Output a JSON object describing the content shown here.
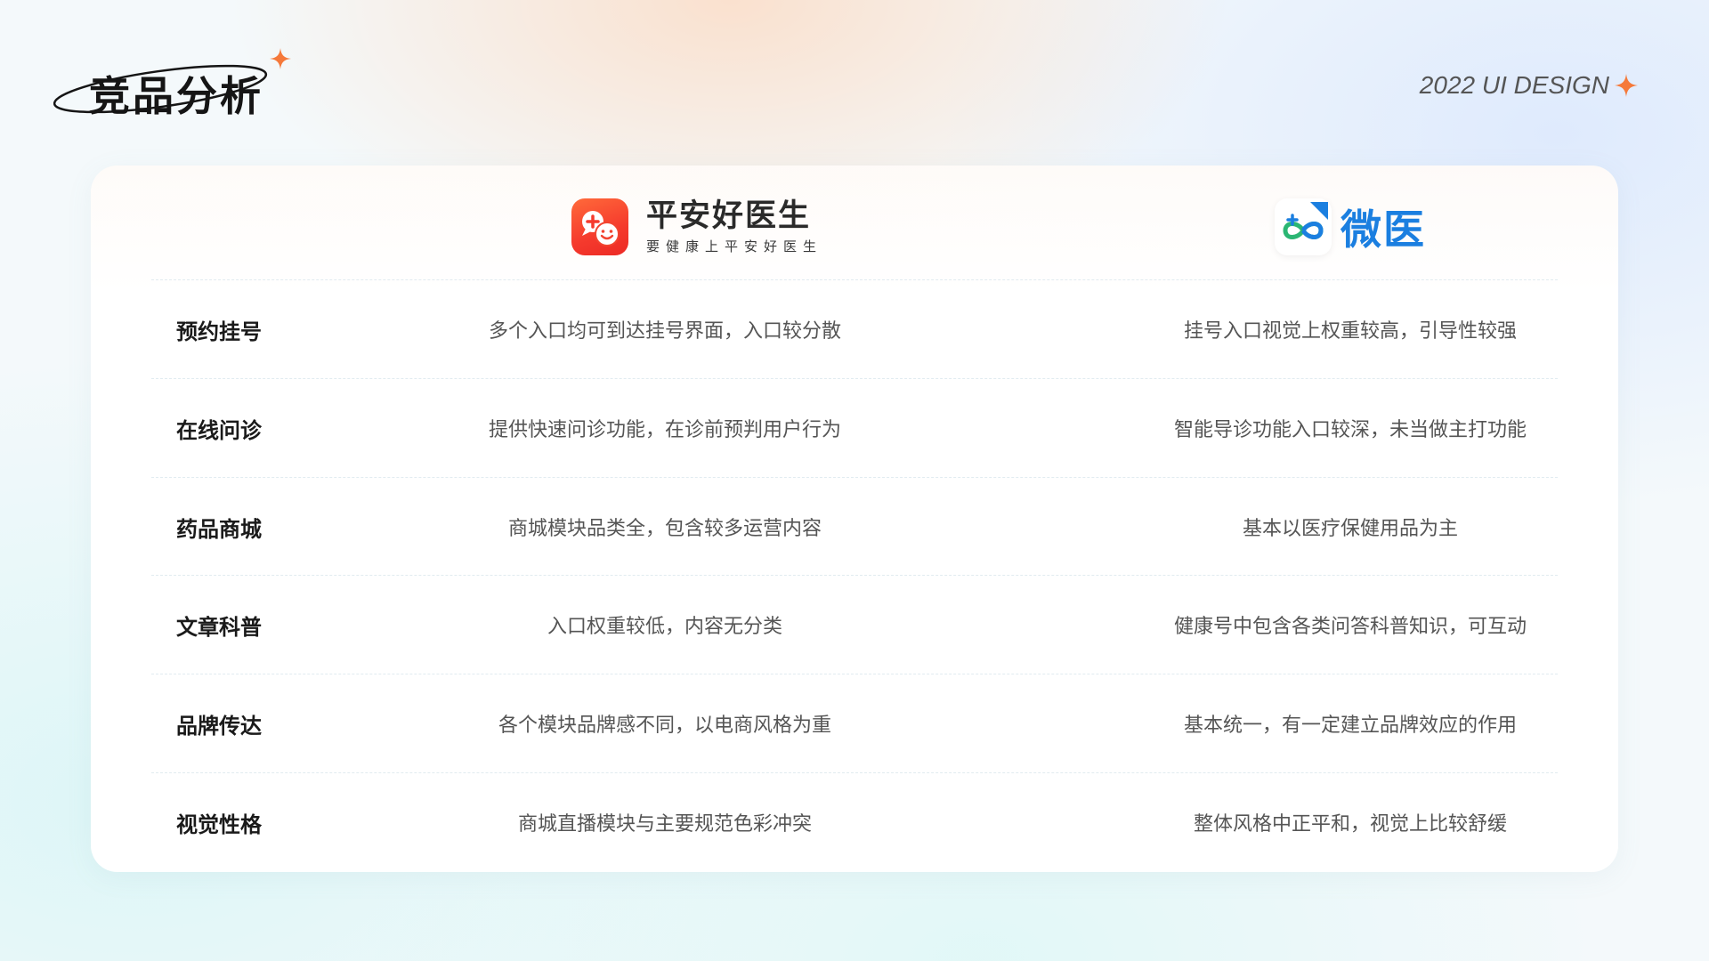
{
  "header": {
    "title": "竞品分析",
    "tag": "2022 UI DESIGN"
  },
  "colors": {
    "accent_orange": "#f5793a",
    "pingan_red": "#f53a2d",
    "weiyi_blue": "#1b7fe0",
    "weiyi_green": "#2bb673"
  },
  "products": {
    "pingan": {
      "name": "平安好医生",
      "slogan": "要健康上平安好医生",
      "icon": "pingan-chat-icon"
    },
    "weiyi": {
      "name": "微医",
      "icon": "weiyi-infinity-icon"
    }
  },
  "rows": [
    {
      "label": "预约挂号",
      "pingan": "多个入口均可到达挂号界面，入口较分散",
      "weiyi": "挂号入口视觉上权重较高，引导性较强"
    },
    {
      "label": "在线问诊",
      "pingan": "提供快速问诊功能，在诊前预判用户行为",
      "weiyi": "智能导诊功能入口较深，未当做主打功能"
    },
    {
      "label": "药品商城",
      "pingan": "商城模块品类全，包含较多运营内容",
      "weiyi": "基本以医疗保健用品为主"
    },
    {
      "label": "文章科普",
      "pingan": "入口权重较低，内容无分类",
      "weiyi": "健康号中包含各类问答科普知识，可互动"
    },
    {
      "label": "品牌传达",
      "pingan": "各个模块品牌感不同，以电商风格为重",
      "weiyi": "基本统一，有一定建立品牌效应的作用"
    },
    {
      "label": "视觉性格",
      "pingan": "商城直播模块与主要规范色彩冲突",
      "weiyi": "整体风格中正平和，视觉上比较舒缓"
    }
  ]
}
